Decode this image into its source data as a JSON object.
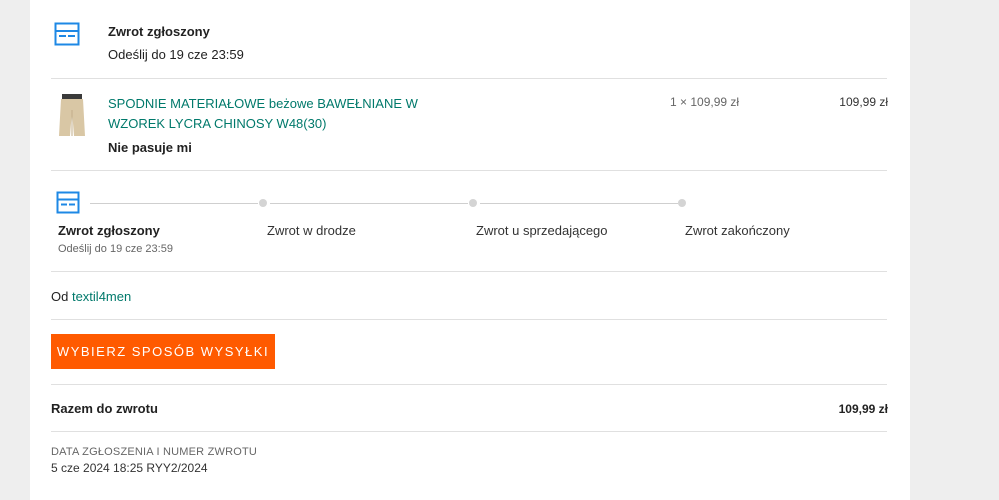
{
  "status_header": {
    "title": "Zwrot zgłoszony",
    "deadline": "Odeślij do 19 cze 23:59"
  },
  "item": {
    "name": "SPODNIE MATERIAŁOWE beżowe BAWEŁNIANE W WZOREK LYCRA CHINOSY W48(30)",
    "quantity_price": "1 × 109,99 zł",
    "total": "109,99 zł",
    "reason": "Nie pasuje mi"
  },
  "progress": {
    "steps": [
      {
        "label": "Zwrot zgłoszony",
        "sub": "Odeślij do 19 cze 23:59",
        "active": true
      },
      {
        "label": "Zwrot w drodze",
        "active": false
      },
      {
        "label": "Zwrot u sprzedającego",
        "active": false
      },
      {
        "label": "Zwrot zakończony",
        "active": false
      }
    ]
  },
  "seller": {
    "prefix": "Od",
    "name": "textil4men"
  },
  "actions": {
    "choose_shipping": "WYBIERZ SPOSÓB WYSYŁKI"
  },
  "summary": {
    "label": "Razem do zwrotu",
    "value": "109,99 zł"
  },
  "meta": {
    "heading": "DATA ZGŁOSZENIA I NUMER ZWROTU",
    "value": "5 cze 2024 18:25 RYY2/2024"
  },
  "colors": {
    "accent": "#ff5a00",
    "link": "#00796b",
    "icon": "#1e88e5"
  }
}
